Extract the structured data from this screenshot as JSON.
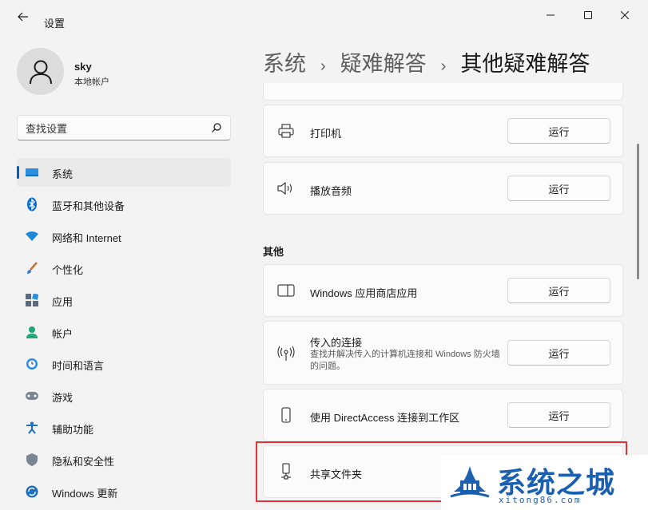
{
  "window": {
    "title": "设置",
    "controls": {
      "minimize": "minimize-icon",
      "maximize": "maximize-icon",
      "close": "close-icon"
    }
  },
  "user": {
    "name": "sky",
    "account_type": "本地帐户"
  },
  "search": {
    "placeholder": "查找设置"
  },
  "sidebar": {
    "items": [
      {
        "label": "系统",
        "icon": "system-display-icon",
        "active": true
      },
      {
        "label": "蓝牙和其他设备",
        "icon": "bluetooth-icon"
      },
      {
        "label": "网络和 Internet",
        "icon": "wifi-icon"
      },
      {
        "label": "个性化",
        "icon": "brush-icon"
      },
      {
        "label": "应用",
        "icon": "apps-icon"
      },
      {
        "label": "帐户",
        "icon": "account-icon"
      },
      {
        "label": "时间和语言",
        "icon": "clock-globe-icon"
      },
      {
        "label": "游戏",
        "icon": "gamepad-icon"
      },
      {
        "label": "辅助功能",
        "icon": "accessibility-icon"
      },
      {
        "label": "隐私和安全性",
        "icon": "shield-icon"
      },
      {
        "label": "Windows 更新",
        "icon": "update-icon"
      }
    ]
  },
  "breadcrumb": [
    "系统",
    "疑难解答",
    "其他疑难解答"
  ],
  "troubleshooters_top": [
    {
      "title": "打印机",
      "button": "运行",
      "icon": "printer-icon"
    },
    {
      "title": "播放音频",
      "button": "运行",
      "icon": "speaker-icon"
    }
  ],
  "section_other": {
    "title": "其他"
  },
  "troubleshooters_other": [
    {
      "title": "Windows 应用商店应用",
      "button": "运行",
      "icon": "store-app-icon"
    },
    {
      "title": "传入的连接",
      "description": "查找并解决传入的计算机连接和 Windows 防火墙的问题。",
      "button": "运行",
      "icon": "incoming-connection-icon"
    },
    {
      "title": "使用 DirectAccess 连接到工作区",
      "button": "运行",
      "icon": "phone-device-icon"
    },
    {
      "title": "共享文件夹",
      "icon": "shared-folder-icon"
    }
  ],
  "watermark": {
    "text": "系统之城",
    "url": "xitong86.com"
  },
  "colors": {
    "accent": "#005fb8",
    "highlight_border": "#e0343a",
    "watermark": "#1b5fb0"
  }
}
